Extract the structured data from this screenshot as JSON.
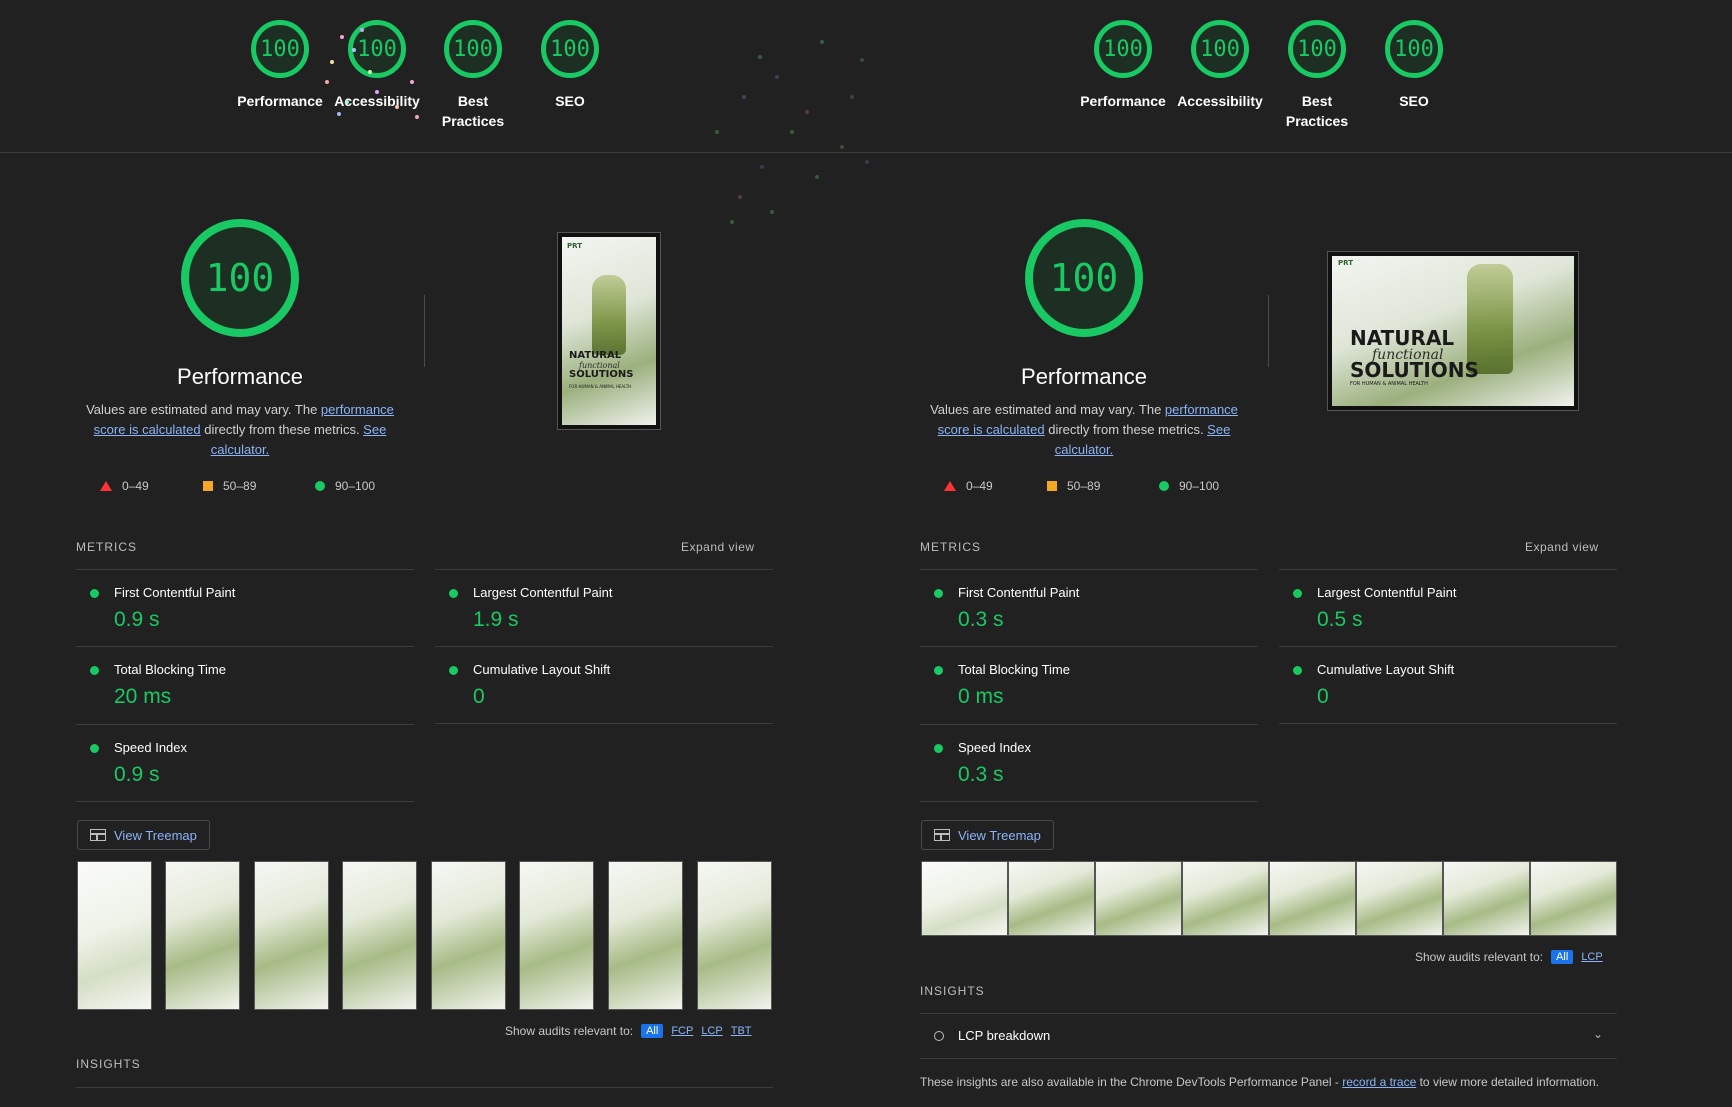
{
  "colors": {
    "good": "#18c964",
    "average": "#f5a623",
    "fail": "#ff3333",
    "link": "#8ab4f8",
    "chip_active": "#1a73e8"
  },
  "top_gauges": {
    "left": [
      {
        "score": "100",
        "label": "Performance"
      },
      {
        "score": "100",
        "label": "Accessibility"
      },
      {
        "score": "100",
        "label": "Best Practices"
      },
      {
        "score": "100",
        "label": "SEO"
      }
    ],
    "right": [
      {
        "score": "100",
        "label": "Performance"
      },
      {
        "score": "100",
        "label": "Accessibility"
      },
      {
        "score": "100",
        "label": "Best Practices"
      },
      {
        "score": "100",
        "label": "SEO"
      }
    ]
  },
  "left": {
    "score": "100",
    "title": "Performance",
    "desc_pre": "Values are estimated and may vary. The ",
    "desc_link1": "performance score is calculated",
    "desc_mid": " directly from these metrics. ",
    "desc_link2": "See calculator.",
    "legend": [
      "0–49",
      "50–89",
      "90–100"
    ],
    "metrics_label": "METRICS",
    "expand": "Expand view",
    "metrics": [
      {
        "name": "First Contentful Paint",
        "value": "0.9 s"
      },
      {
        "name": "Largest Contentful Paint",
        "value": "1.9 s"
      },
      {
        "name": "Total Blocking Time",
        "value": "20 ms"
      },
      {
        "name": "Cumulative Layout Shift",
        "value": "0"
      },
      {
        "name": "Speed Index",
        "value": "0.9 s"
      }
    ],
    "treemap": "View Treemap",
    "show_audits": "Show audits relevant to:",
    "chips": [
      "All",
      "FCP",
      "LCP",
      "TBT"
    ],
    "insights_label": "INSIGHTS",
    "screenshot": {
      "logo": "PRT",
      "line1": "NATURAL",
      "line2": "functional",
      "line3": "SOLUTIONS",
      "sub": "FOR HUMAN & ANIMAL HEALTH"
    }
  },
  "right": {
    "score": "100",
    "title": "Performance",
    "desc_pre": "Values are estimated and may vary. The ",
    "desc_link1": "performance score is calculated",
    "desc_mid": " directly from these metrics. ",
    "desc_link2": "See calculator.",
    "legend": [
      "0–49",
      "50–89",
      "90–100"
    ],
    "metrics_label": "METRICS",
    "expand": "Expand view",
    "metrics": [
      {
        "name": "First Contentful Paint",
        "value": "0.3 s"
      },
      {
        "name": "Largest Contentful Paint",
        "value": "0.5 s"
      },
      {
        "name": "Total Blocking Time",
        "value": "0 ms"
      },
      {
        "name": "Cumulative Layout Shift",
        "value": "0"
      },
      {
        "name": "Speed Index",
        "value": "0.3 s"
      }
    ],
    "treemap": "View Treemap",
    "show_audits": "Show audits relevant to:",
    "chips": [
      "All",
      "LCP"
    ],
    "insights_label": "INSIGHTS",
    "insight_item": "LCP breakdown",
    "footer_pre": "These insights are also available in the Chrome DevTools Performance Panel - ",
    "footer_link": "record a trace",
    "footer_post": " to view more detailed information.",
    "screenshot": {
      "logo": "PRT",
      "line1": "NATURAL",
      "line2": "functional",
      "line3": "SOLUTIONS",
      "sub": "FOR HUMAN & ANIMAL HEALTH"
    }
  }
}
